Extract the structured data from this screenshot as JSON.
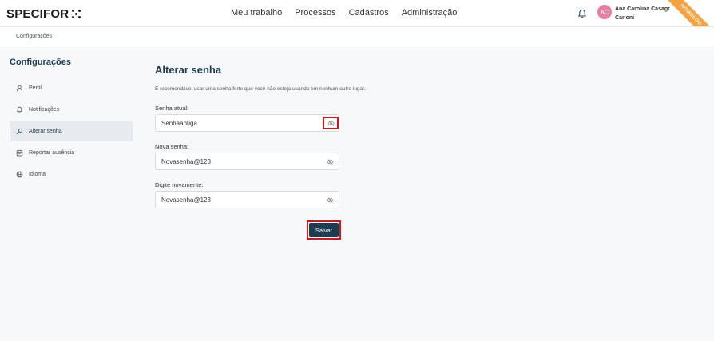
{
  "header": {
    "logo_text": "SPECIFOR",
    "nav": [
      "Meu trabalho",
      "Processos",
      "Cadastros",
      "Administração"
    ],
    "avatar_initials": "AC",
    "user_name_line1": "Ana Carolina Casagr",
    "user_name_line2": "Carioni",
    "env_badge": "HOMOLOG",
    "env_badge_color": "#f4a340",
    "avatar_color": "#e87ea1"
  },
  "breadcrumb": "Configurações",
  "sidebar": {
    "title": "Configurações",
    "items": [
      {
        "label": "Perfil",
        "icon": "user-icon",
        "active": false
      },
      {
        "label": "Notificações",
        "icon": "bell-icon",
        "active": false
      },
      {
        "label": "Alterar senha",
        "icon": "key-icon",
        "active": true
      },
      {
        "label": "Reportar ausência",
        "icon": "calendar-icon",
        "active": false
      },
      {
        "label": "Idioma",
        "icon": "globe-icon",
        "active": false
      }
    ]
  },
  "form": {
    "title": "Alterar senha",
    "hint": "É recomendável usar uma senha forte que você não esteja usando em nenhum outro lugar.",
    "current_label": "Senha atual:",
    "current_value": "Senhaantiga",
    "new_label": "Nova senha:",
    "new_value": "Novasenha@123",
    "confirm_label": "Digite novamente:",
    "confirm_value": "Novasenha@123",
    "save_label": "Salvar"
  },
  "colors": {
    "primary": "#1d3c50",
    "highlight": "#d8141b"
  }
}
